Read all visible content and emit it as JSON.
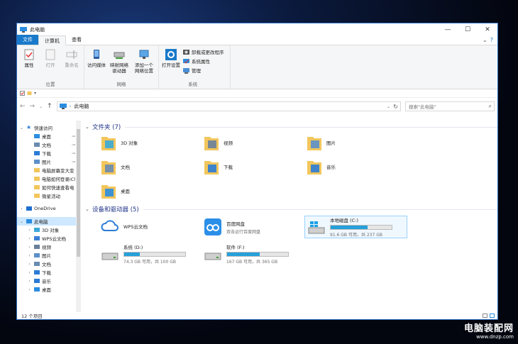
{
  "window": {
    "title": "此电脑",
    "controls": [
      "—",
      "☐",
      "✕"
    ]
  },
  "tabs": [
    {
      "label": "文件"
    },
    {
      "label": "计算机"
    },
    {
      "label": "查看"
    }
  ],
  "ribbon": {
    "groups": [
      {
        "label": "位置",
        "items": [
          {
            "label": "属性"
          },
          {
            "label": "打开"
          },
          {
            "label": "重命名"
          }
        ]
      },
      {
        "label": "网络",
        "items": [
          {
            "label": "访问媒体"
          },
          {
            "label": "映射网络驱动器"
          },
          {
            "label": "添加一个网络位置"
          }
        ]
      },
      {
        "label": "系统",
        "items": [
          {
            "label": "打开设置"
          }
        ],
        "small": [
          {
            "label": "卸载或更改程序"
          },
          {
            "label": "系统属性"
          },
          {
            "label": "管理"
          }
        ]
      }
    ]
  },
  "address": {
    "path": "此电脑",
    "search_placeholder": "搜索\"此电脑\""
  },
  "sidebar": {
    "items": [
      {
        "label": "快速访问",
        "color": "#2b7bd6"
      },
      {
        "label": "桌面",
        "color": "#2b8de0",
        "pin": true
      },
      {
        "label": "文档",
        "color": "#6a8bb0",
        "pin": true
      },
      {
        "label": "下载",
        "color": "#2b7bd6",
        "pin": true
      },
      {
        "label": "图片",
        "color": "#5b8fc9",
        "pin": true
      },
      {
        "label": "电脑屏幕变大变",
        "color": "#f2c65c"
      },
      {
        "label": "电脑如何登录iCl",
        "color": "#f2c65c"
      },
      {
        "label": "如何快速查看电",
        "color": "#f2c65c"
      },
      {
        "label": "微星活动",
        "color": "#f2c65c"
      },
      {
        "label": "OneDrive",
        "color": "#1f6fd1"
      },
      {
        "label": "此电脑",
        "color": "#2b8de0"
      },
      {
        "label": "3D 对象",
        "color": "#3aa8d8"
      },
      {
        "label": "WPS云文档",
        "color": "#3a7fd6"
      },
      {
        "label": "视频",
        "color": "#6a7f99"
      },
      {
        "label": "图片",
        "color": "#5b8fc9"
      },
      {
        "label": "文档",
        "color": "#6a8bb0"
      },
      {
        "label": "下载",
        "color": "#2b7bd6"
      },
      {
        "label": "音乐",
        "color": "#2b7bd6"
      },
      {
        "label": "桌面",
        "color": "#2b8de0"
      }
    ]
  },
  "folders": {
    "header": "文件夹 (7)",
    "items": [
      {
        "label": "3D 对象",
        "color": "#3aa8d8"
      },
      {
        "label": "视频",
        "color": "#6a7f99"
      },
      {
        "label": "图片",
        "color": "#5b8fc9"
      },
      {
        "label": "文档",
        "color": "#6a8bb0"
      },
      {
        "label": "下载",
        "color": "#2b7bd6"
      },
      {
        "label": "音乐",
        "color": "#2b7bd6"
      },
      {
        "label": "桌面",
        "color": "#2b8de0"
      }
    ]
  },
  "drives": {
    "header": "设备和驱动器 (5)",
    "items": [
      {
        "label": "WPS云文档",
        "sub": "",
        "kind": "cloud"
      },
      {
        "label": "百度网盘",
        "sub": "双击运行百度网盘",
        "kind": "baidu"
      },
      {
        "label": "本地磁盘 (C:)",
        "sub": "91.6 GB 可用，共 237 GB",
        "used": 0.61,
        "kind": "win"
      },
      {
        "label": "系统 (D:)",
        "sub": "74.3 GB 可用，共 100 GB",
        "used": 0.26,
        "kind": "hdd"
      },
      {
        "label": "软件 (F:)",
        "sub": "167 GB 可用，共 365 GB",
        "used": 0.54,
        "kind": "hdd"
      }
    ]
  },
  "status": {
    "count": "12 个项目"
  },
  "watermark": {
    "line1": "电脑装配网",
    "line2": "www.dnzp.com"
  }
}
